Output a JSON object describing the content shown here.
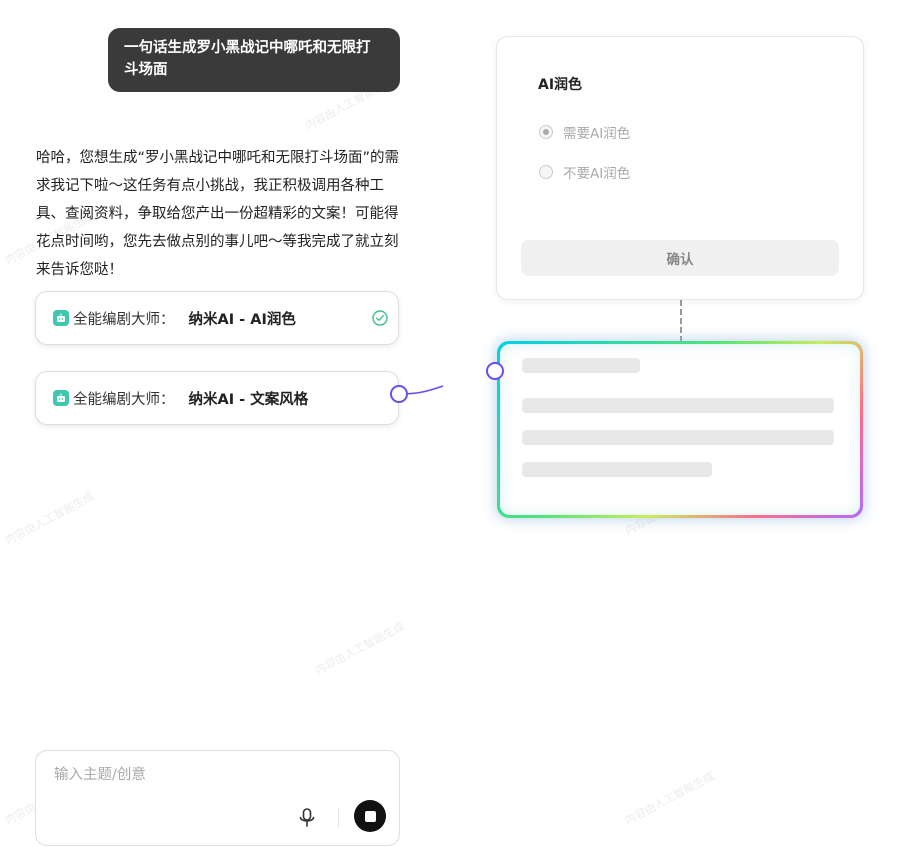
{
  "chat": {
    "user_message": "一句话生成罗小黑战记中哪吒和无限打斗场面",
    "ai_message": "哈哈，您想生成“罗小黑战记中哪吒和无限打斗场面”的需求我记下啦～这任务有点小挑战，我正积极调用各种工具、查阅资料，争取给您产出一份超精彩的文案！可能得花点时间哟，您先去做点别的事儿吧～等我完成了就立刻来告诉您哒！"
  },
  "tool_calls": [
    {
      "agent": "全能编剧大师：",
      "tool": "纳米AI - AI润色",
      "status": "done",
      "icon": "robot-icon"
    },
    {
      "agent": "全能编剧大师：",
      "tool": "纳米AI - 文案风格",
      "status": "running",
      "icon": "robot-icon"
    }
  ],
  "polish_panel": {
    "title": "AI润色",
    "options": [
      {
        "label": "需要AI润色",
        "selected": true
      },
      {
        "label": "不要AI润色",
        "selected": false
      }
    ],
    "confirm_label": "确认"
  },
  "input": {
    "placeholder": "输入主题/创意",
    "value": ""
  },
  "colors": {
    "accent": "#6c4cf2",
    "success": "#3ebf8a",
    "user_bubble": "#3a3a3a"
  }
}
